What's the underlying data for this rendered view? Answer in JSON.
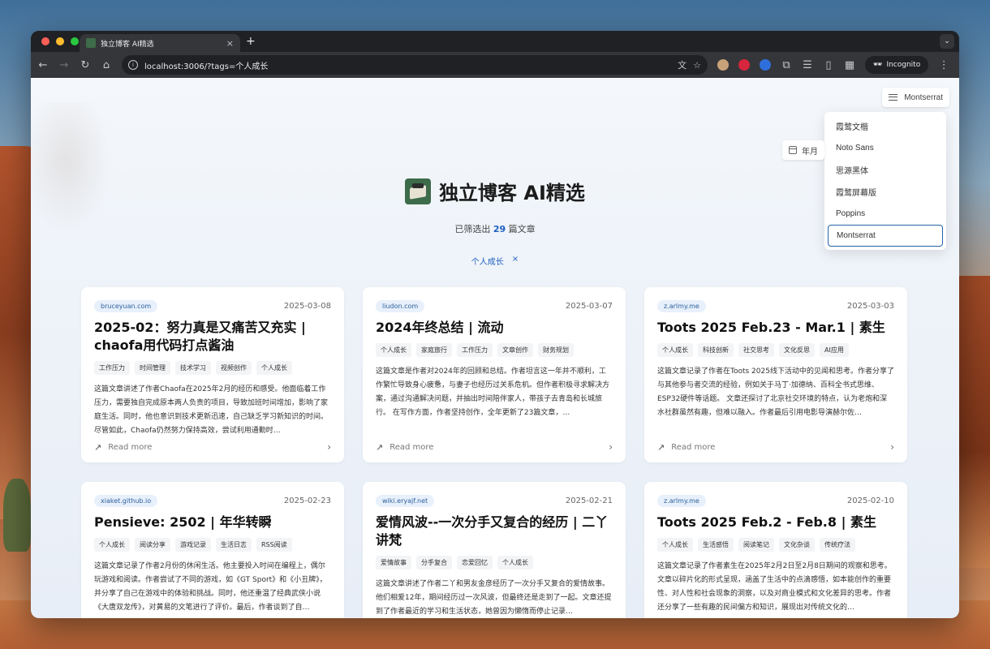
{
  "browser": {
    "tab_title": "独立博客 AI精选",
    "tab_close": "×",
    "new_tab": "+",
    "url": "localhost:3006/?tags=个人成长",
    "incognito_label": "Incognito"
  },
  "header": {
    "font_button_label": "Montserrat",
    "year_button_label": "年月",
    "font_menu": [
      "霞鹜文楷",
      "Noto Sans",
      "思源黑体",
      "霞鹜屏幕版",
      "Poppins",
      "Montserrat"
    ],
    "font_menu_selected": "Montserrat"
  },
  "hero": {
    "title": "独立博客 AI精选",
    "count_prefix": "已筛选出",
    "count": "29",
    "count_suffix": "篇文章",
    "active_tag": "个人成长",
    "clear_tag": "×"
  },
  "read_more_label": "Read more",
  "cards": [
    {
      "domain": "bruceyuan.com",
      "date": "2025-03-08",
      "title": "2025-02：努力真是又痛苦又充实 | chaofa用代码打点酱油",
      "tags": [
        "工作压力",
        "时间管理",
        "技术学习",
        "视频创作",
        "个人成长"
      ],
      "summary": "这篇文章讲述了作者Chaofa在2025年2月的经历和感受。他面临着工作压力，需要独自完成原本两人负责的项目，导致加班时间增加，影响了家庭生活。同时，他也意识到技术更新迅速，自己缺乏学习新知识的时间。尽管如此，Chaofa仍然努力保持高效，尝试利用通勤时…"
    },
    {
      "domain": "liudon.com",
      "date": "2025-03-07",
      "title": "2024年终总结 | 流动",
      "tags": [
        "个人成长",
        "家庭旅行",
        "工作压力",
        "文章创作",
        "财务规划"
      ],
      "summary": "这篇文章是作者对2024年的回顾和总结。作者坦言这一年并不顺利，工作繁忙导致身心疲惫，与妻子也经历过关系危机。但作者积极寻求解决方案，通过沟通解决问题，并抽出时间陪伴家人，带孩子去青岛和长城旅行。 在写作方面，作者坚持创作，全年更新了23篇文章，…"
    },
    {
      "domain": "z.arlmy.me",
      "date": "2025-03-03",
      "title": "Toots 2025 Feb.23 - Mar.1 | 素生",
      "tags": [
        "个人成长",
        "科技创新",
        "社交思考",
        "文化反思",
        "AI应用"
      ],
      "summary": "这篇文章记录了作者在Toots 2025线下活动中的见闻和思考。作者分享了与其他参与者交流的经验，例如关于马丁·加德纳、百科全书式思维、ESP32硬件等话题。 文章还探讨了北京社交环境的特点，认为老炮和深水社群虽然有趣，但难以融入。作者最后引用电影导演赫尔佐…"
    },
    {
      "domain": "xiaket.github.io",
      "date": "2025-02-23",
      "title": "Pensieve: 2502 | 年华转瞬",
      "tags": [
        "个人成长",
        "阅读分享",
        "游戏记录",
        "生活日志",
        "RSS阅读"
      ],
      "summary": "这篇文章记录了作者2月份的休闲生活。他主要投入时间在编程上，偶尔玩游戏和阅读。作者尝试了不同的游戏，如《GT Sport》和《小丑牌》，并分享了自己在游戏中的体验和挑战。同时，他还重温了经典武侠小说《大唐双龙传》，对黄易的文笔进行了评价。最后，作者谈到了自…"
    },
    {
      "domain": "wiki.eryajf.net",
      "date": "2025-02-21",
      "title": "爱情风波--一次分手又复合的经历 | 二丫讲梵",
      "tags": [
        "爱情故事",
        "分手复合",
        "恋爱回忆",
        "个人成长"
      ],
      "summary": "这篇文章讲述了作者二丫和男友金彦经历了一次分手又复合的爱情故事。他们相爱12年，期间经历过一次风波，但最终还是走到了一起。文章还提到了作者最近的学习和生活状态，她曾因为懒惰而停止记录…"
    },
    {
      "domain": "z.arlmy.me",
      "date": "2025-02-10",
      "title": "Toots 2025 Feb.2 - Feb.8 | 素生",
      "tags": [
        "个人成长",
        "生活感悟",
        "阅读笔记",
        "文化杂谈",
        "传统疗法"
      ],
      "summary": "这篇文章记录了作者素生在2025年2月2日至2月8日期间的观察和思考。文章以碎片化的形式呈现，涵盖了生活中的点滴感悟，如本能创作的重要性、对人性和社会现象的洞察，以及对商业模式和文化差异的思考。作者还分享了一些有趣的民间偏方和知识，展现出对传统文化的…"
    }
  ]
}
